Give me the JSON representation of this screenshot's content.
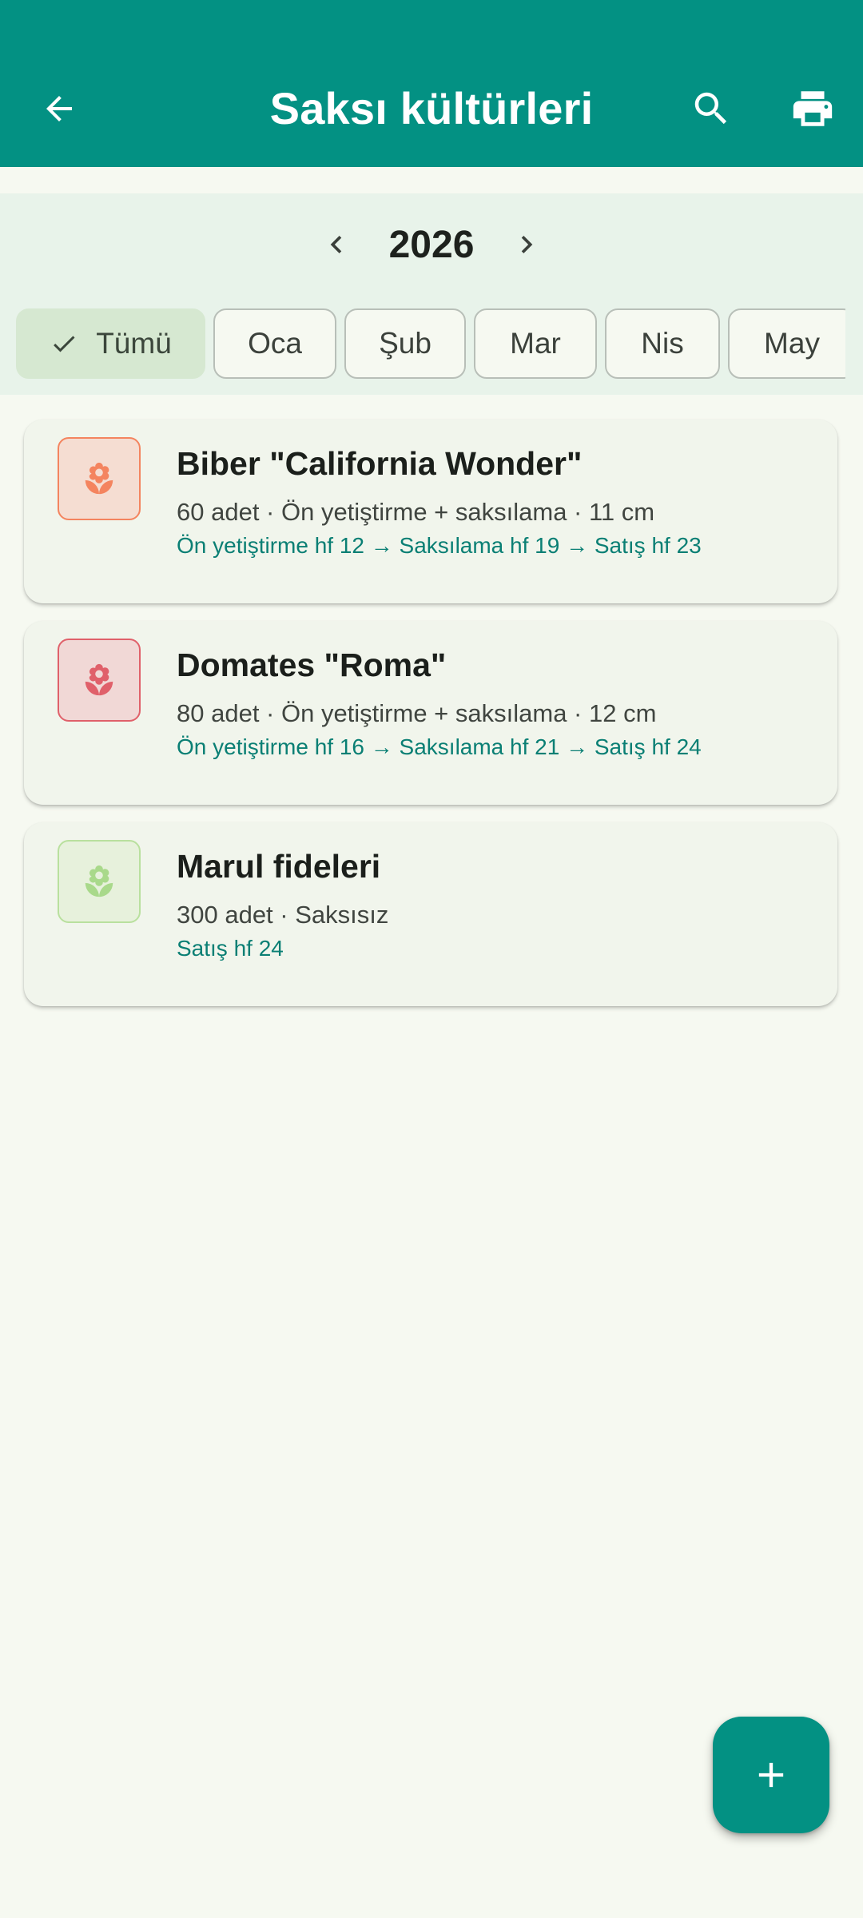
{
  "appbar": {
    "title": "Saksı kültürleri",
    "back_icon": "arrow-back-icon",
    "search_icon": "search-icon",
    "print_icon": "print-icon",
    "background_color": "#039183"
  },
  "year_selector": {
    "year": "2026",
    "prev_icon": "chevron-left-icon",
    "next_icon": "chevron-right-icon"
  },
  "month_chips": [
    {
      "label": "Tümü",
      "selected": true
    },
    {
      "label": "Oca",
      "selected": false
    },
    {
      "label": "Şub",
      "selected": false
    },
    {
      "label": "Mar",
      "selected": false
    },
    {
      "label": "Nis",
      "selected": false
    },
    {
      "label": "May",
      "selected": false
    }
  ],
  "cultures": [
    {
      "name": "Biber \"California Wonder\"",
      "meta": "60 adet · Ön yetiştirme + saksılama · 11 cm",
      "schedule": "Ön yetiştirme hf 12 → Saksılama hf 19 → Satış hf 23",
      "icon": "flower-icon",
      "icon_color": "#f4845f",
      "badge_bg": "#f5ddd2",
      "badge_border": "#f4845f"
    },
    {
      "name": "Domates \"Roma\"",
      "meta": "80 adet · Ön yetiştirme + saksılama · 12 cm",
      "schedule": "Ön yetiştirme hf 16 → Saksılama hf 21 → Satış hf 24",
      "icon": "flower-icon",
      "icon_color": "#e0606a",
      "badge_bg": "#f1d8d6",
      "badge_border": "#e0606a"
    },
    {
      "name": "Marul fideleri",
      "meta": "300 adet · Saksısız",
      "schedule": "Satış hf 24",
      "icon": "flower-icon",
      "icon_color": "#a9d98b",
      "badge_bg": "#e7f1dc",
      "badge_border": "#b9e09e"
    }
  ],
  "fab": {
    "icon": "add-icon"
  }
}
